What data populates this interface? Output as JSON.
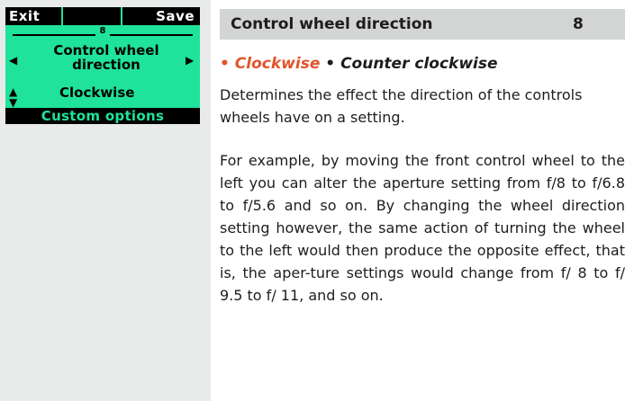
{
  "lcd": {
    "exit_label": "Exit",
    "save_label": "Save",
    "page_number": "8",
    "setting_title": "Control wheel direction",
    "setting_value": "Clockwise",
    "footer_label": "Custom options",
    "icons": {
      "left": "left-arrow-icon",
      "right": "right-arrow-icon",
      "updown": "up-down-arrows-icon"
    }
  },
  "section": {
    "title": "Control wheel direction",
    "page": "8"
  },
  "options": {
    "bullet": "•",
    "selected": "Clockwise",
    "other": "Counter clockwise"
  },
  "description": {
    "p1": "Determines the effect the direction of the controls wheels have on a setting.",
    "p2": "For example, by moving the front control wheel to the left you can alter the aperture setting from f/8 to f/6.8 to f/5.6 and so on. By changing the wheel direction setting however, the same action of turning the wheel to the left would then produce the opposite effect, that is, the aper-ture settings would change from f/ 8 to f/ 9.5 to f/ 11, and so on."
  },
  "colors": {
    "lcd_background": "#1fe39a",
    "highlight": "#e2542c",
    "header_bar": "#d3d4d4",
    "sidebar": "#e9eaea"
  }
}
